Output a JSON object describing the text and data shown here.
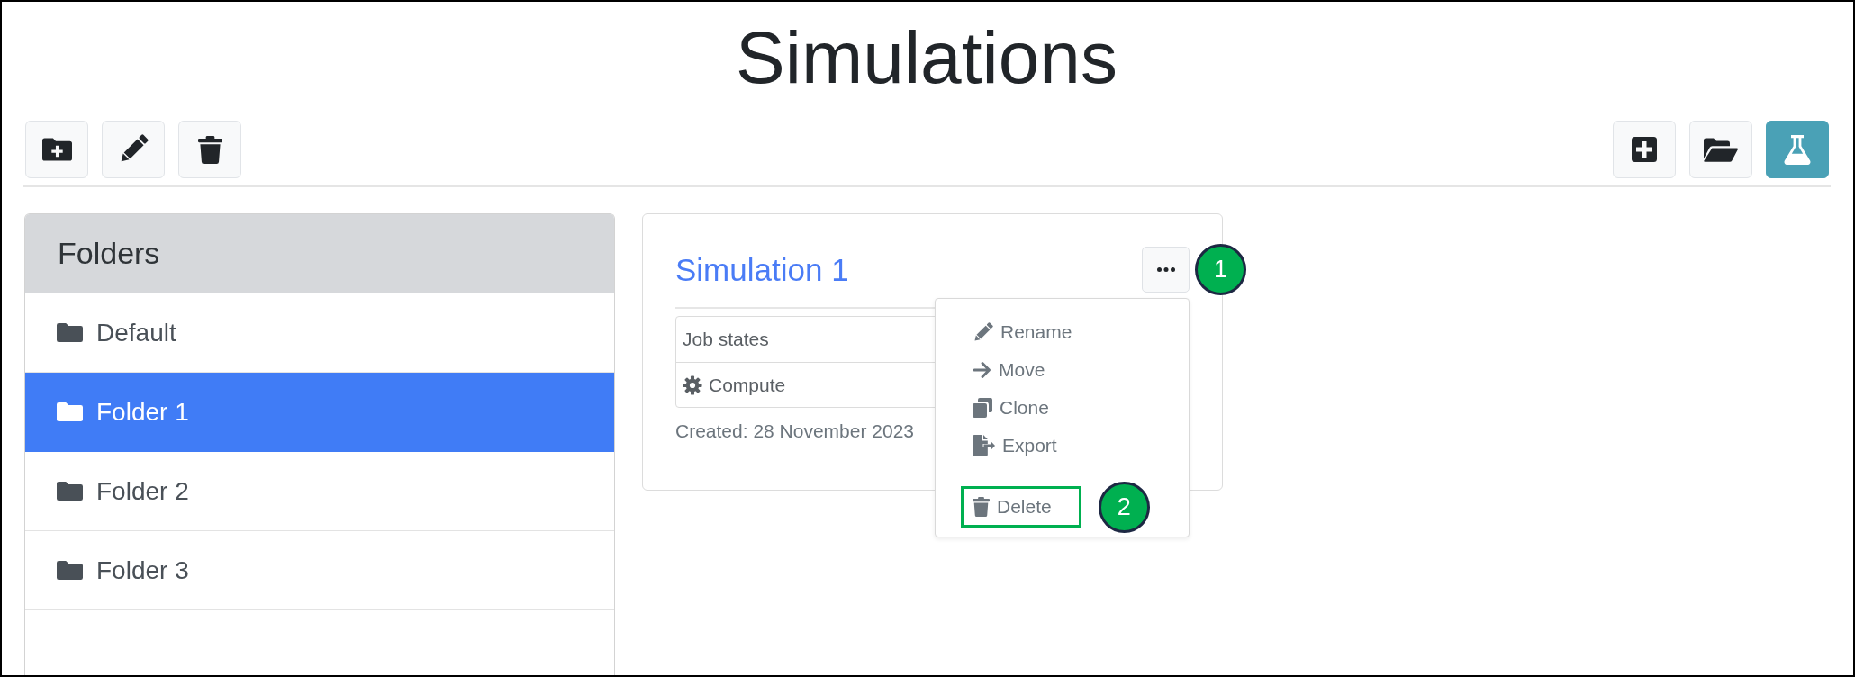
{
  "page": {
    "title": "Simulations"
  },
  "toolbar": {
    "left": [
      {
        "kind": "newfolder",
        "active": false
      },
      {
        "kind": "edit",
        "active": false
      },
      {
        "kind": "delete",
        "active": false
      }
    ],
    "right": [
      {
        "kind": "add",
        "active": false
      },
      {
        "kind": "open",
        "active": false
      },
      {
        "kind": "lab",
        "active": true
      }
    ]
  },
  "sidebar": {
    "title": "Folders",
    "items": [
      {
        "label": "Default",
        "selected": false
      },
      {
        "label": "Folder 1",
        "selected": true
      },
      {
        "label": "Folder 2",
        "selected": false
      },
      {
        "label": "Folder 3",
        "selected": false
      }
    ]
  },
  "card": {
    "title": "Simulation 1",
    "menu_button": {
      "callout": "1"
    },
    "job_states": {
      "heading": "Job states",
      "items": [
        {
          "label": "Compute"
        }
      ]
    },
    "created": "Created: 28 November 2023",
    "menu": {
      "open": true,
      "sections": [
        {
          "items": [
            {
              "kind": "rename",
              "label": "Rename",
              "highlighted": false
            },
            {
              "kind": "move",
              "label": "Move",
              "highlighted": false
            },
            {
              "kind": "clone",
              "label": "Clone",
              "highlighted": false
            },
            {
              "kind": "export",
              "label": "Export",
              "highlighted": false
            }
          ]
        },
        {
          "items": [
            {
              "kind": "delete",
              "label": "Delete",
              "highlighted": true,
              "callout": "2"
            }
          ]
        }
      ]
    }
  }
}
